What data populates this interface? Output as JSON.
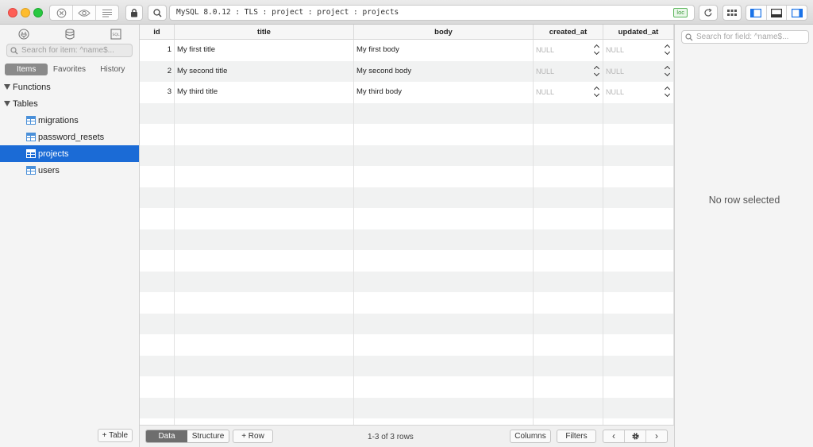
{
  "toolbar": {
    "connection": "MySQL 8.0.12 : TLS : project : project : projects",
    "badge": "loc"
  },
  "sidebar": {
    "search_placeholder": "Search for item: ^name$...",
    "tabs": [
      "Items",
      "Favorites",
      "History"
    ],
    "active_tab": "Items",
    "sections": [
      "Functions",
      "Tables"
    ],
    "tables": [
      "migrations",
      "password_resets",
      "projects",
      "users"
    ],
    "selected_table": "projects",
    "add_table_label": "+ Table"
  },
  "grid": {
    "columns": [
      "id",
      "title",
      "body",
      "created_at",
      "updated_at"
    ],
    "rows": [
      [
        "1",
        "My first title",
        "My first body",
        "NULL",
        "NULL"
      ],
      [
        "2",
        "My second title",
        "My second body",
        "NULL",
        "NULL"
      ],
      [
        "3",
        "My third title",
        "My third body",
        "NULL",
        "NULL"
      ]
    ]
  },
  "bottombar": {
    "data_label": "Data",
    "structure_label": "Structure",
    "add_row_label": "+ Row",
    "row_count": "1-3 of 3 rows",
    "columns_label": "Columns",
    "filters_label": "Filters"
  },
  "details": {
    "search_placeholder": "Search for field: ^name$...",
    "empty_text": "No row selected"
  },
  "colors": {
    "selection": "#1b6bd6",
    "close": "#fe5f57",
    "minimize": "#febc2e",
    "zoom": "#28c840"
  }
}
